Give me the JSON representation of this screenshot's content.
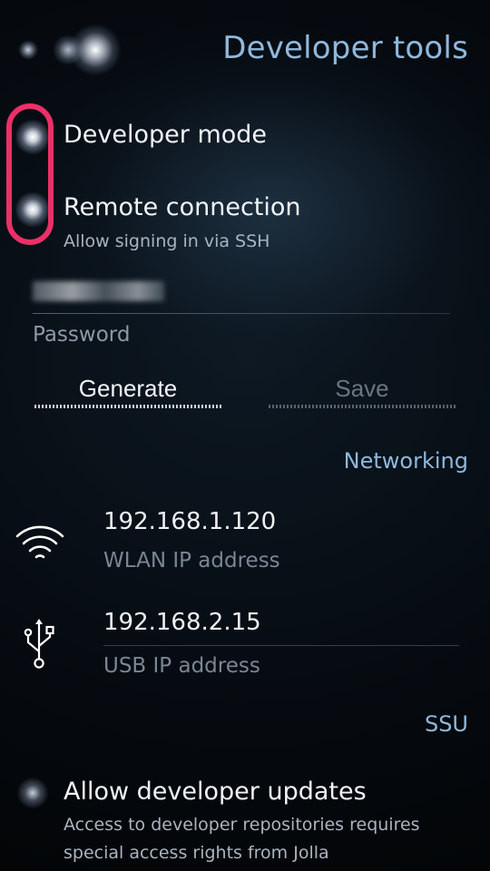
{
  "page": {
    "title": "Developer tools"
  },
  "developer_mode": {
    "label": "Developer mode",
    "enabled": true
  },
  "remote_connection": {
    "label": "Remote connection",
    "description": "Allow signing in via SSH",
    "enabled": true
  },
  "username_field": {
    "value_redacted": true
  },
  "password": {
    "label": "Password",
    "generate_label": "Generate",
    "save_label": "Save"
  },
  "networking": {
    "header": "Networking",
    "wlan": {
      "ip": "192.168.1.120",
      "label": "WLAN IP address",
      "icon": "wifi-icon"
    },
    "usb": {
      "ip": "192.168.2.15",
      "label": "USB IP address",
      "icon": "usb-icon"
    }
  },
  "ssu": {
    "header": "SSU",
    "allow_updates": {
      "label": "Allow developer updates",
      "description_line1": "Access to developer repositories requires",
      "description_line2": "special access rights from Jolla",
      "enabled": false
    }
  },
  "colors": {
    "accent": "#8fb8dc",
    "highlight": "#ea3068",
    "primary_text": "#f1f4f8",
    "secondary_text": "#a9b4c0"
  }
}
